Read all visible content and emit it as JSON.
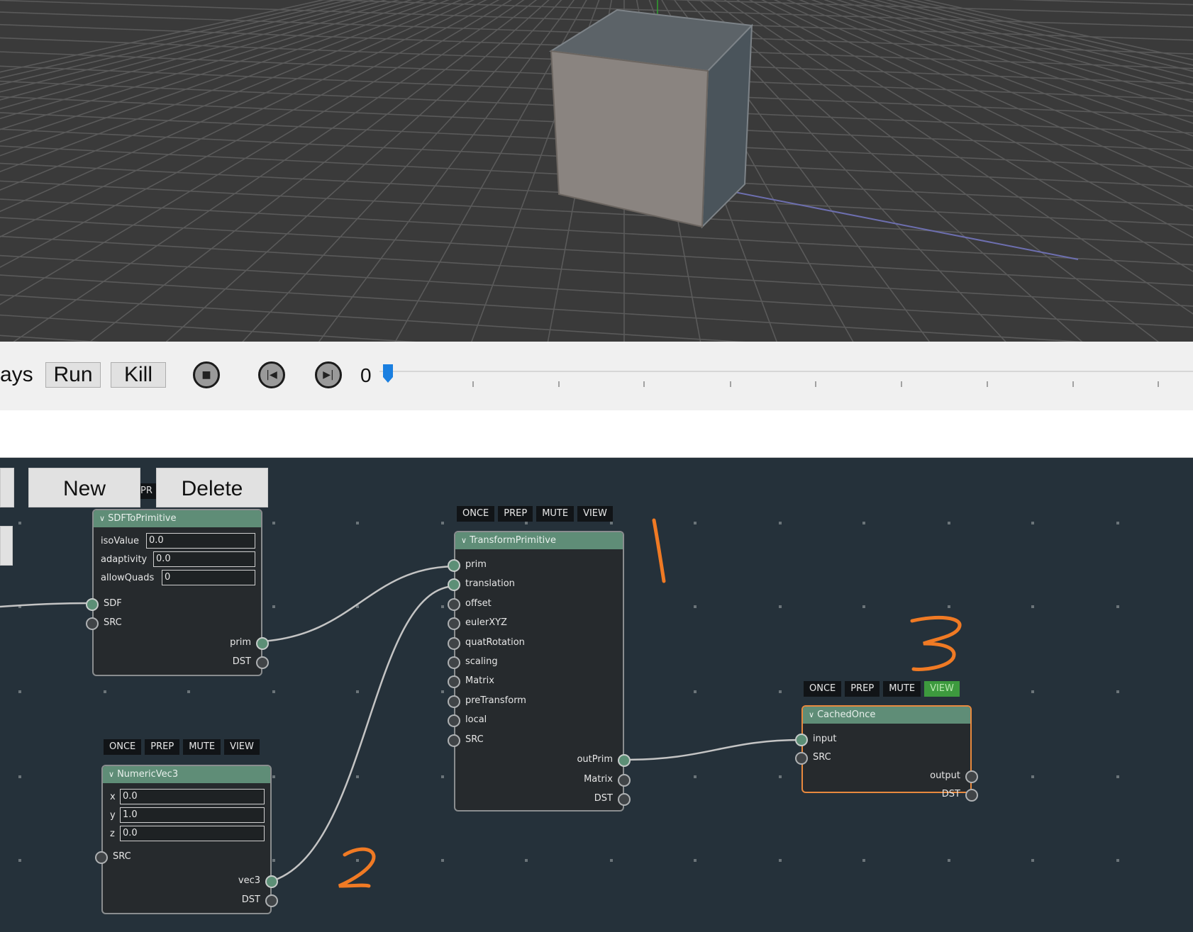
{
  "viewport": {
    "name": "3d-viewport"
  },
  "timebar": {
    "days_label": "ays",
    "run_label": "Run",
    "kill_label": "Kill",
    "frame": "0"
  },
  "graph_toolbar": {
    "new_label": "New",
    "delete_label": "Delete",
    "partial_label": "PR"
  },
  "flags": [
    "ONCE",
    "PREP",
    "MUTE",
    "VIEW"
  ],
  "nodes": {
    "sdf": {
      "title": "SDFToPrimitive",
      "params": [
        {
          "label": "isoValue",
          "value": "0.0"
        },
        {
          "label": "adaptivity",
          "value": "0.0"
        },
        {
          "label": "allowQuads",
          "value": "0"
        }
      ],
      "inputs": [
        "SDF",
        "SRC"
      ],
      "outputs": [
        "prim",
        "DST"
      ]
    },
    "transform": {
      "title": "TransformPrimitive",
      "inputs": [
        "prim",
        "translation",
        "offset",
        "eulerXYZ",
        "quatRotation",
        "scaling",
        "Matrix",
        "preTransform",
        "local",
        "SRC"
      ],
      "outputs": [
        "outPrim",
        "Matrix",
        "DST"
      ]
    },
    "vec3": {
      "title": "NumericVec3",
      "params": [
        {
          "label": "x",
          "value": "0.0"
        },
        {
          "label": "y",
          "value": "1.0"
        },
        {
          "label": "z",
          "value": "0.0"
        }
      ],
      "inputs": [
        "SRC"
      ],
      "outputs": [
        "vec3",
        "DST"
      ]
    },
    "cached": {
      "title": "CachedOnce",
      "inputs": [
        "input",
        "SRC"
      ],
      "outputs": [
        "output",
        "DST"
      ]
    }
  },
  "colors": {
    "graph_bg": "#25313a",
    "node_header": "#5f8d77",
    "selected_border": "#e8893e",
    "annotation": "#f07a24",
    "view_active": "#3d9a3e"
  }
}
